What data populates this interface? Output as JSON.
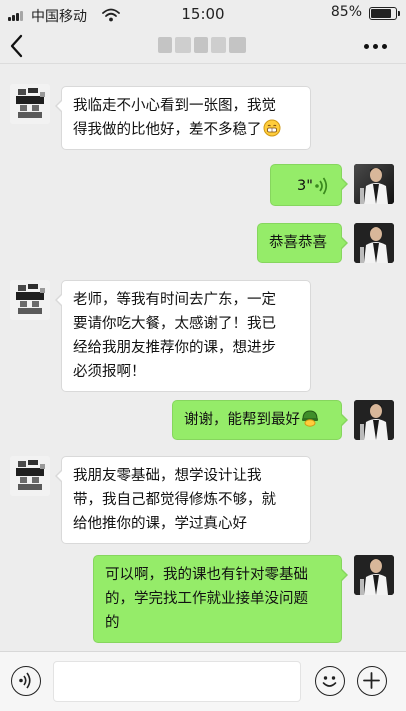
{
  "status_bar": {
    "carrier": "中国移动",
    "time": "15:00",
    "battery": "85%",
    "battery_level": 0.85
  },
  "nav": {
    "back_icon": "back-chevron-icon",
    "more_icon": "more-dots-icon"
  },
  "messages": [
    {
      "side": "left",
      "lines": [
        "我临走不小心看到一张图，我觉",
        "得我做的比他好，差不多稳了"
      ],
      "emoji": "grin-emoji"
    },
    {
      "side": "right",
      "type": "voice",
      "duration": "3\""
    },
    {
      "side": "right",
      "lines": [
        "恭喜恭喜"
      ]
    },
    {
      "side": "left",
      "lines": [
        "老师，等我有时间去广东，一定",
        "要请你吃大餐，太感谢了！我已",
        "经给我朋友推荐你的课，想进步",
        "必须报啊！"
      ]
    },
    {
      "side": "right",
      "lines": [
        "谢谢，能帮到最好"
      ],
      "emoji": "helmet-emoji"
    },
    {
      "side": "left",
      "lines": [
        "我朋友零基础，想学设计让我",
        "带，我自己都觉得修炼不够，就",
        "给他推你的课，学过真心好"
      ]
    },
    {
      "side": "right",
      "lines": [
        "可以啊，我的课也有针对零基础",
        "的，学完找工作就业接单没问题",
        "的"
      ]
    }
  ],
  "input_bar": {
    "voice_icon": "voice-input-icon",
    "emoji_icon": "emoji-icon",
    "plus_icon": "plus-icon"
  }
}
